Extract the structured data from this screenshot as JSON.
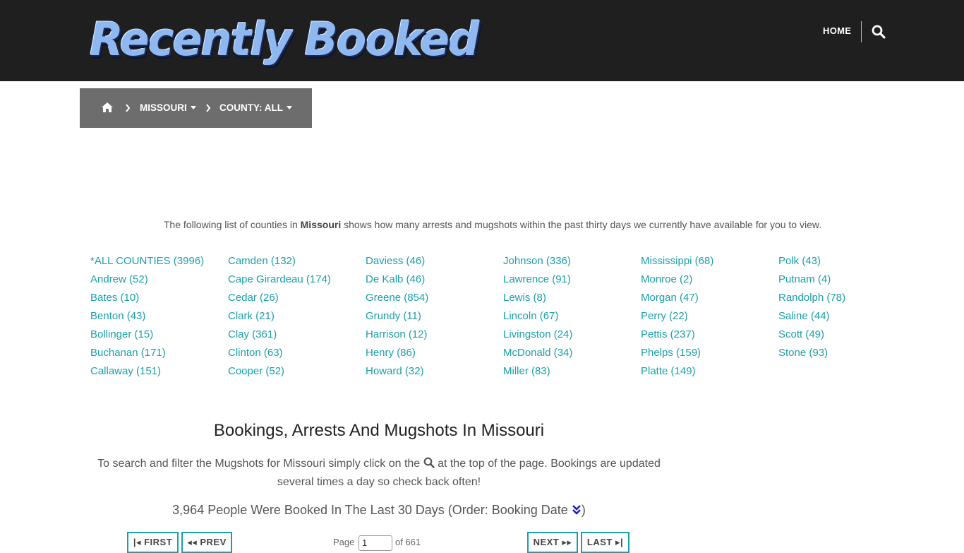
{
  "header": {
    "logo_text": "Recently Booked",
    "nav_home": "HOME"
  },
  "breadcrumb": {
    "state": "MISSOURI",
    "county": "COUNTY: ALL"
  },
  "intro": {
    "before": "The following list of counties in ",
    "state": "Missouri",
    "after": " shows how many arrests and mugshots within the past thirty days we currently have available for you to view."
  },
  "counties": [
    [
      "*ALL COUNTIES (3996)",
      "Andrew (52)",
      "Bates (10)",
      "Benton (43)",
      "Bollinger (15)",
      "Buchanan (171)",
      "Callaway (151)"
    ],
    [
      "Camden (132)",
      "Cape Girardeau (174)",
      "Cedar (26)",
      "Clark (21)",
      "Clay (361)",
      "Clinton (63)",
      "Cooper (52)"
    ],
    [
      "Daviess (46)",
      "De Kalb (46)",
      "Greene (854)",
      "Grundy (11)",
      "Harrison (12)",
      "Henry (86)",
      "Howard (32)"
    ],
    [
      "Johnson (336)",
      "Lawrence (91)",
      "Lewis (8)",
      "Lincoln (67)",
      "Livingston (24)",
      "McDonald (34)",
      "Miller (83)"
    ],
    [
      "Mississippi (68)",
      "Monroe (2)",
      "Morgan (47)",
      "Perry (22)",
      "Pettis (237)",
      "Phelps (159)",
      "Platte (149)"
    ],
    [
      "Polk (43)",
      "Putnam (4)",
      "Randolph (78)",
      "Saline (44)",
      "Scott (49)",
      "Stone (93)"
    ]
  ],
  "main": {
    "title": "Bookings, Arrests And Mugshots In Missouri",
    "desc_before": "To search and filter the Mugshots for Missouri simply click on the ",
    "desc_after": " at the top of the page. Bookings are updated several times a day so check back often!",
    "booked_text": "3,964 People Were Booked In The Last 30 Days (Order: Booking Date ",
    "booked_close": ")"
  },
  "pagination": {
    "first": "FIRST",
    "prev": "PREV",
    "page_label": "Page",
    "page_value": "1",
    "of_label": "of 661",
    "next": "NEXT",
    "last": "LAST"
  },
  "colors": {
    "header_bg": "#1f1f1f",
    "breadcrumb_bg": "#6d6d6d",
    "link": "#1aa0a8",
    "order_icon": "#1a1acc"
  }
}
